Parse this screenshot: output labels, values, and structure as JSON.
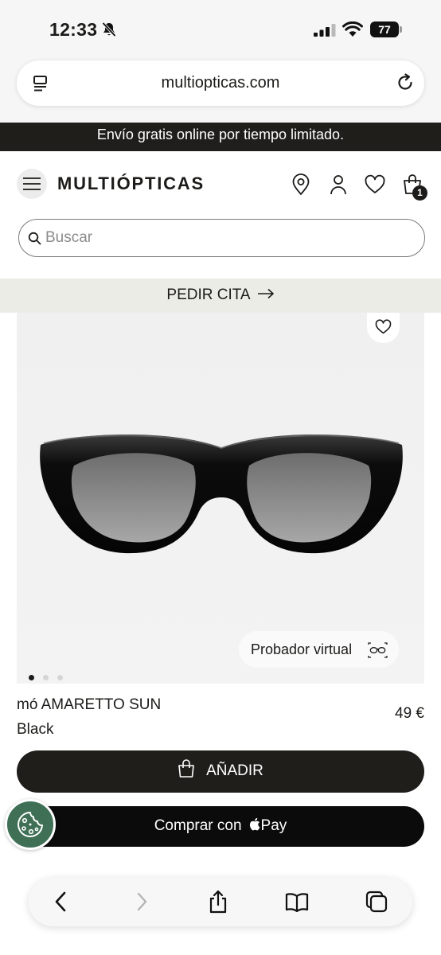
{
  "status_bar": {
    "time": "12:33",
    "battery": "77",
    "icons": [
      "bell-off-icon",
      "cellular-signal-icon",
      "wifi-icon",
      "battery-icon"
    ]
  },
  "browser": {
    "url": "multiopticas.com",
    "reader_icon": "reader-mode-icon",
    "reload_icon": "reload-icon"
  },
  "promo_banner": {
    "text": "Envío gratis online por tiempo limitado."
  },
  "header": {
    "logo": "MULTIÓPTICAS",
    "icons": [
      "menu-icon",
      "location-pin-icon",
      "account-icon",
      "heart-icon",
      "shopping-bag-icon"
    ],
    "cart_count": "1"
  },
  "search": {
    "placeholder": "Buscar",
    "value": ""
  },
  "appointment": {
    "label": "PEDIR CITA"
  },
  "product": {
    "name": "mó AMARETTO SUN",
    "color": "Black",
    "price": "49 €",
    "virtual_tryon_label": "Probador virtual",
    "image_dots": {
      "count": 3,
      "active": 0
    }
  },
  "actions": {
    "add_label": "AÑADIR",
    "apple_pay_prefix": "Comprar con",
    "apple_pay_suffix": "Pay"
  },
  "toolbar": {
    "items": [
      "back-icon",
      "forward-icon",
      "share-icon",
      "bookmarks-icon",
      "tabs-icon"
    ]
  },
  "colors": {
    "dark": "#1f1e1b",
    "cita_background": "#ecece7",
    "cookie_button": "#3f6f55",
    "page_background": "#ffffff"
  }
}
